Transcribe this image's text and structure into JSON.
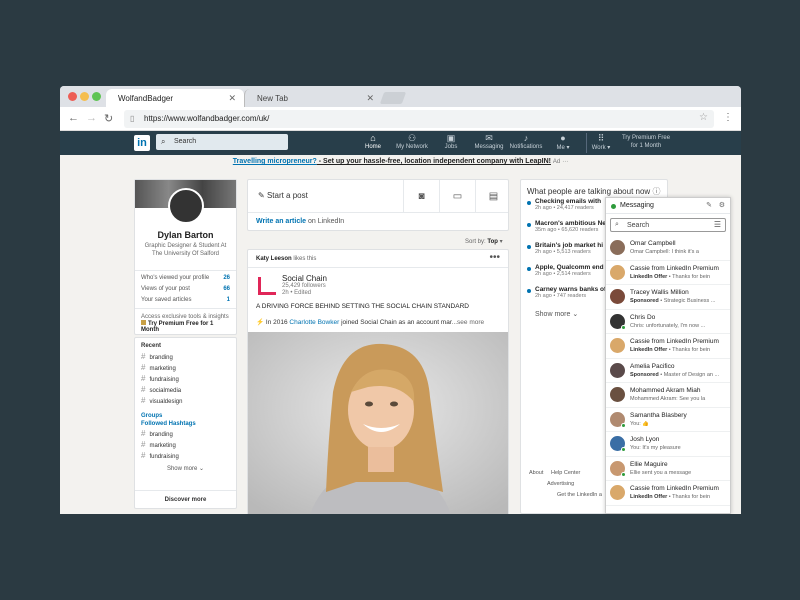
{
  "browser": {
    "tabs": [
      {
        "title": "WolfandBadger"
      },
      {
        "title": "New Tab"
      }
    ],
    "url": "https://www.wolfandbadger.com/uk/",
    "traffic_lights": [
      "#ed5e56",
      "#f5be4f",
      "#5fc454"
    ]
  },
  "nav": {
    "logo": "in",
    "search_placeholder": "Search",
    "items": [
      {
        "label": "Home",
        "icon": "home-icon",
        "glyph": "⌂"
      },
      {
        "label": "My Network",
        "icon": "network-icon",
        "glyph": "👥"
      },
      {
        "label": "Jobs",
        "icon": "briefcase-icon",
        "glyph": "▣"
      },
      {
        "label": "Messaging",
        "icon": "chat-icon",
        "glyph": "✉"
      },
      {
        "label": "Notifications",
        "icon": "bell-icon",
        "glyph": "♫"
      },
      {
        "label": "Me ▾",
        "icon": "avatar-icon",
        "glyph": "●"
      },
      {
        "label": "Work ▾",
        "icon": "grid-icon",
        "glyph": "⋮⋮"
      }
    ],
    "premium": "Try Premium Free for 1 Month"
  },
  "promo": {
    "link": "Travelling micropreneur?",
    "text": " - Set up your hassle-free, location independent company with LeapIN!",
    "ad": "Ad",
    "dots": "···"
  },
  "profile": {
    "name": "Dylan Barton",
    "title": "Graphic Designer & Student At The University Of Salford",
    "stats": [
      {
        "label": "Who's viewed your profile",
        "value": "26"
      },
      {
        "label": "Views of your post",
        "value": "66"
      },
      {
        "label": "Your saved articles",
        "value": "1"
      }
    ],
    "premium_text": "Access exclusive tools & insights",
    "premium_cta": "Try Premium Free for 1 Month"
  },
  "recent": {
    "title": "Recent",
    "tags": [
      "branding",
      "marketing",
      "fundraising",
      "socialmedia",
      "visualdesign"
    ],
    "groups": "Groups",
    "followed": "Followed Hashtags",
    "followed_tags": [
      "branding",
      "marketing",
      "fundraising"
    ],
    "show_more": "Show more ⌄",
    "discover": "Discover more"
  },
  "share": {
    "start_post": "Start a post",
    "write_article": "Write an article",
    "on_linkedin": " on LinkedIn",
    "sort_label": "Sort by:",
    "sort_value": "Top"
  },
  "post": {
    "liker": "Katy Leeson",
    "likes_text": " likes this",
    "company": "Social Chain",
    "followers": "25,429 followers",
    "meta": "2h • Edited",
    "headline": "A DRIVING FORCE BEHIND SETTING THE SOCIAL CHAIN STANDARD",
    "mention_pre": "⚡ In 2016 ",
    "mention_name": "Charlotte Bowker",
    "mention_post": " joined Social Chain as an account mar",
    "see_more": "...see more"
  },
  "trends": {
    "title": "What people are talking about now",
    "items": [
      {
        "title": "Checking emails with",
        "meta": "2h ago • 24,417 readers"
      },
      {
        "title": "Macron's ambitious Ne",
        "meta": "35m ago • 65,620 readers"
      },
      {
        "title": "Britain's job market hi",
        "meta": "2h ago • 5,513 readers"
      },
      {
        "title": "Apple, Qualcomm end",
        "meta": "2h ago • 2,514 readers"
      },
      {
        "title": "Carney warns banks of",
        "meta": "2h ago • 747 readers"
      }
    ],
    "show_more": "Show more ⌄",
    "footer": [
      "About",
      "Help Center",
      "Advertising",
      "Get the LinkedIn a"
    ]
  },
  "messaging": {
    "title": "Messaging",
    "search_placeholder": "Search",
    "conversations": [
      {
        "name": "Omar Campbell",
        "preview": "Omar Campbell: I think it's a",
        "tag": "",
        "color": "#8a6d5a",
        "online": false
      },
      {
        "name": "Cassie from LinkedIn Premium",
        "preview": "Thanks for bein",
        "tag": "LinkedIn Offer",
        "color": "#d9a86a",
        "online": false
      },
      {
        "name": "Tracey Wallis Million",
        "preview": "Strategic Business ...",
        "tag": "Sponsored",
        "color": "#7a4a3a",
        "online": false
      },
      {
        "name": "Chris Do",
        "preview": "Chris: unfortunately, I'm now ...",
        "tag": "",
        "color": "#333333",
        "online": true
      },
      {
        "name": "Cassie from LinkedIn Premium",
        "preview": "Thanks for bein",
        "tag": "LinkedIn Offer",
        "color": "#d9a86a",
        "online": false
      },
      {
        "name": "Amelia Pacifico",
        "preview": "Master of Design an ...",
        "tag": "Sponsored",
        "color": "#5a4a4a",
        "online": false
      },
      {
        "name": "Mohammed Akram Miah",
        "preview": "Mohammed Akram: See you la",
        "tag": "",
        "color": "#6a5040",
        "online": false
      },
      {
        "name": "Samantha Blasbery",
        "preview": "You: 👍",
        "tag": "",
        "color": "#b08a70",
        "online": true
      },
      {
        "name": "Josh Lyon",
        "preview": "You: It's my pleasure",
        "tag": "",
        "color": "#3a6ea5",
        "online": true
      },
      {
        "name": "Ellie Maguire",
        "preview": "Ellie sent you a message",
        "tag": "",
        "color": "#c89870",
        "online": true
      },
      {
        "name": "Cassie from LinkedIn Premium",
        "preview": "Thanks for bein",
        "tag": "LinkedIn Offer",
        "color": "#d9a86a",
        "online": false
      }
    ]
  }
}
